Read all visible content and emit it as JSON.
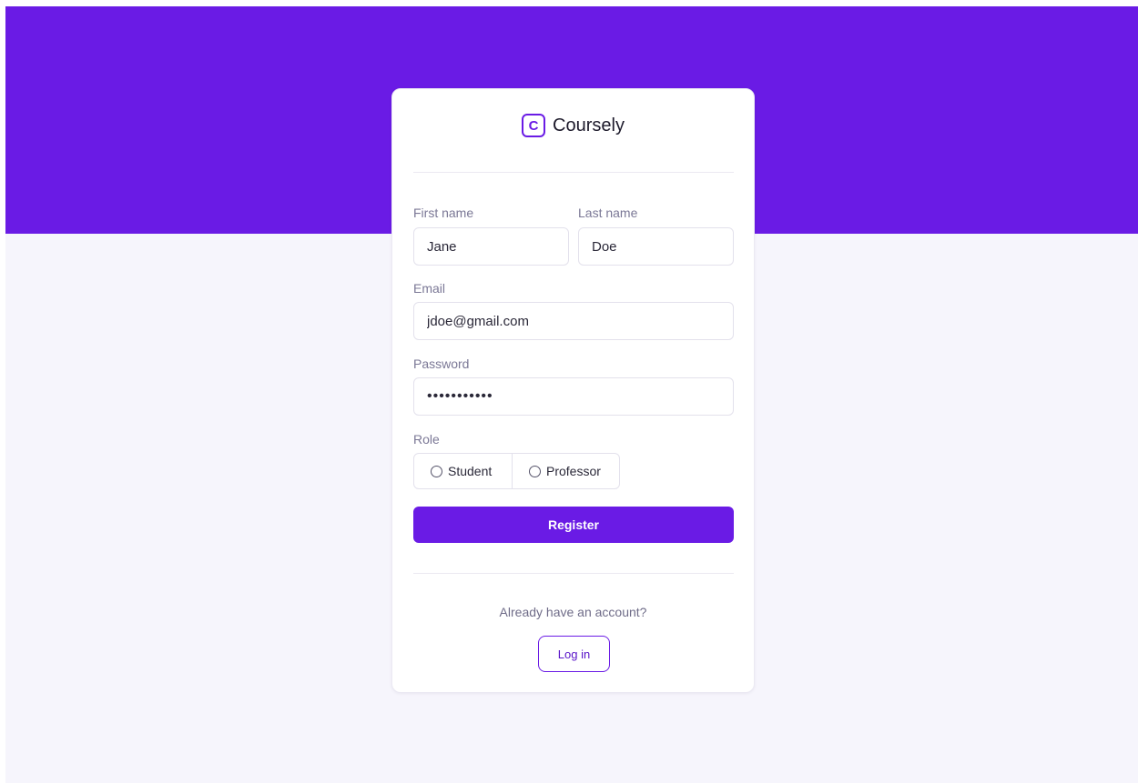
{
  "colors": {
    "brand": "#6a1be5",
    "page_background": "#f6f5fc",
    "card_background": "#ffffff"
  },
  "brand": {
    "icon_letter": "C",
    "icon_name": "logo-icon",
    "name": "Coursely"
  },
  "form": {
    "first_name": {
      "label": "First name",
      "value": "Jane"
    },
    "last_name": {
      "label": "Last name",
      "value": "Doe"
    },
    "email": {
      "label": "Email",
      "value": "jdoe@gmail.com"
    },
    "password": {
      "label": "Password",
      "value": "•••••••••••"
    },
    "role": {
      "label": "Role",
      "options": [
        "Student",
        "Professor"
      ]
    },
    "submit_label": "Register"
  },
  "footer": {
    "prompt": "Already have an account?",
    "login_label": "Log in"
  }
}
